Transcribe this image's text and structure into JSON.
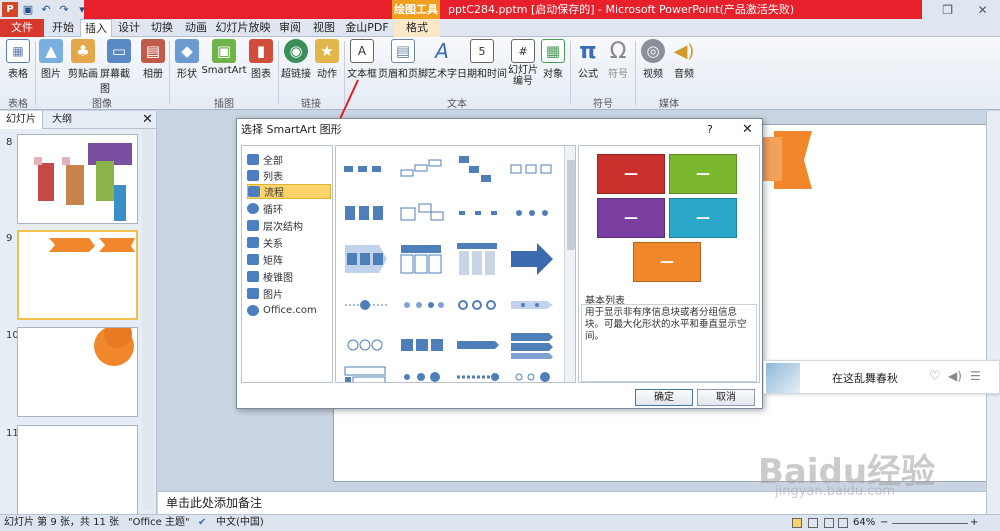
{
  "window": {
    "context_label": "绘图工具",
    "title": "pptC284.pptm [启动保存的] - Microsoft PowerPoint(产品激活失败)"
  },
  "tabs": [
    {
      "label": "文件"
    },
    {
      "label": "开始"
    },
    {
      "label": "插入"
    },
    {
      "label": "设计"
    },
    {
      "label": "切换"
    },
    {
      "label": "动画"
    },
    {
      "label": "幻灯片放映"
    },
    {
      "label": "审阅"
    },
    {
      "label": "视图"
    },
    {
      "label": "金山PDF"
    },
    {
      "label": "格式"
    }
  ],
  "ribbon": {
    "buttons": {
      "table": "表格",
      "picture": "图片",
      "clipart": "剪贴画",
      "screenshot": "屏幕截图",
      "album": "相册",
      "shapes": "形状",
      "smartart": "SmartArt",
      "chart": "图表",
      "hyperlink": "超链接",
      "action": "动作",
      "textbox": "文本框",
      "header_footer": "页眉和页脚",
      "wordart": "艺术字",
      "datetime": "日期和时间",
      "slide_number": "幻灯片\n编号",
      "object": "对象",
      "equation": "公式",
      "symbol": "符号",
      "video": "视频",
      "audio": "音频"
    },
    "groups": {
      "tables": "表格",
      "images": "图像",
      "illustrations": "插图",
      "links": "链接",
      "text": "文本",
      "symbols": "符号",
      "media": "媒体"
    }
  },
  "left_panel": {
    "tab_slides": "幻灯片",
    "tab_outline": "大纲",
    "slides": [
      "8",
      "9",
      "10",
      "11"
    ]
  },
  "dialog": {
    "title": "选择 SmartArt 图形",
    "help": "?",
    "categories": [
      "全部",
      "列表",
      "流程",
      "循环",
      "层次结构",
      "关系",
      "矩阵",
      "棱锥图",
      "图片",
      "Office.com"
    ],
    "selected_category": "流程",
    "preview_name": "基本列表",
    "preview_desc": "用于显示非有序信息块或者分组信息块。可最大化形状的水平和垂直显示空间。",
    "ok": "确定",
    "cancel": "取消",
    "preview_colors": [
      "#c9302c",
      "#7cb82f",
      "#7a3ea1",
      "#2ba8c9",
      "#f0872a"
    ]
  },
  "notes": {
    "placeholder": "单击此处添加备注"
  },
  "music": {
    "title": "在这乱舞春秋"
  },
  "status": {
    "slide_info": "幻灯片 第 9 张，共 11 张",
    "theme": "\"Office 主题\"",
    "language": "中文(中国)",
    "zoom": "64%"
  },
  "watermark": {
    "brand": "Baidu经验",
    "url": "jingyan.baidu.com"
  },
  "colors": {
    "accent_red": "#e8202c",
    "tool_orange": "#f0a020",
    "selection": "#fdd46b"
  }
}
